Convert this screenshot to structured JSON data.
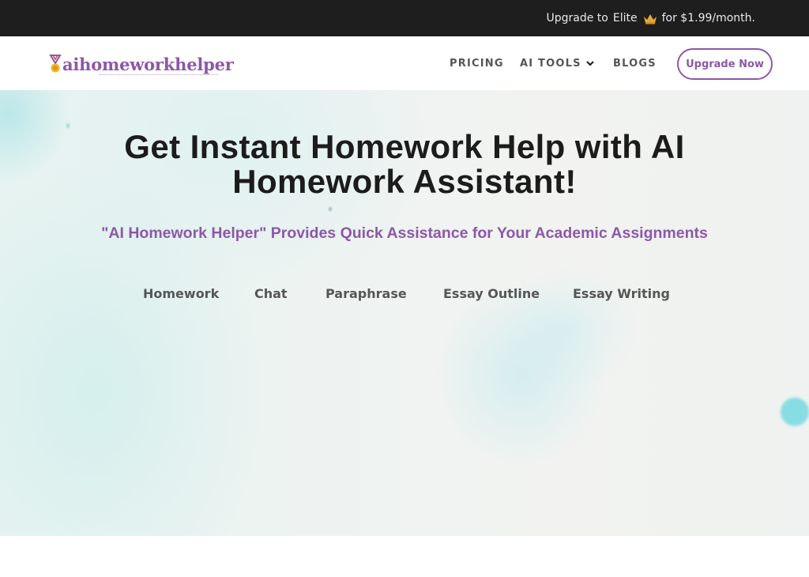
{
  "promo_bar": {
    "text_before": "Upgrade to",
    "tier": "Elite",
    "icon": "crown-icon",
    "text_after": "for $1.99/month."
  },
  "header": {
    "logo_text": "aihomeworkhelper",
    "logo_icon": "medal-icon",
    "nav": [
      {
        "label": "PRICING"
      },
      {
        "label": "AI TOOLS",
        "icon": "chevron-down-icon"
      },
      {
        "label": "BLOGS"
      }
    ],
    "cta_label": "Upgrade Now"
  },
  "hero": {
    "title_line1": "Get Instant Homework Help with AI",
    "title_line2": "Homework Assistant!",
    "subtitle": "\"AI Homework Helper\" Provides Quick Assistance for Your Academic Assignments",
    "tools": [
      {
        "label": "Homework"
      },
      {
        "label": "Chat"
      },
      {
        "label": "Paraphrase"
      },
      {
        "label": "Essay Outline"
      },
      {
        "label": "Essay Writing"
      }
    ]
  },
  "colors": {
    "brand_purple": "#8c58a8",
    "promo_bg": "#1e1e1e",
    "title_text": "#1c1c1c",
    "tool_text": "#565656",
    "accent_cyan": "#86dde3"
  }
}
